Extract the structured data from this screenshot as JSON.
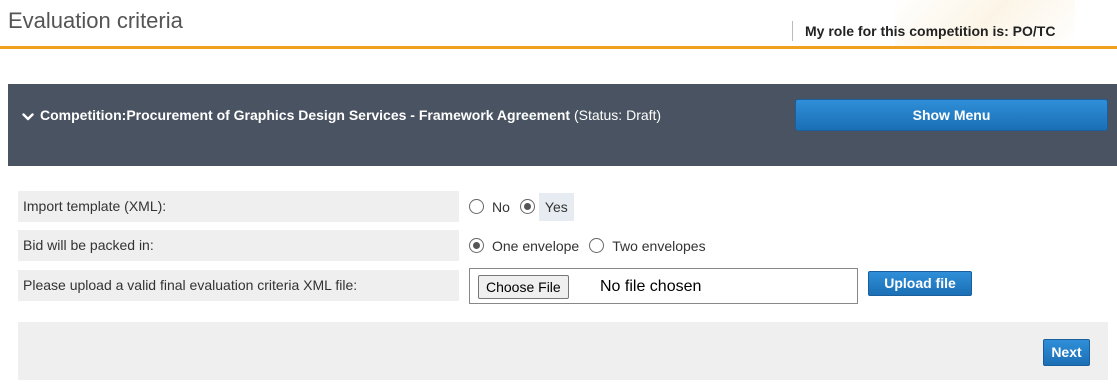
{
  "header": {
    "title": "Evaluation criteria",
    "role_text": "My role for this competition is: PO/TC",
    "accent_color": "#f0a01e"
  },
  "competition": {
    "label": "Competition:Procurement of Graphics Design Services - Framework Agreement",
    "status_text": " (Status: Draft)",
    "toggle_icon": "chevron-down-icon",
    "show_menu_label": "Show Menu",
    "bar_color": "#4a5361"
  },
  "form": {
    "import_template": {
      "label": "Import template (XML):",
      "options": [
        "No",
        "Yes"
      ],
      "selected": "Yes"
    },
    "bid_packing": {
      "label": "Bid will be packed in:",
      "options": [
        "One envelope",
        "Two envelopes"
      ],
      "selected": "One envelope"
    },
    "upload": {
      "label": "Please upload a valid final evaluation criteria XML file:",
      "choose_file_label": "Choose File",
      "file_status": "No file chosen",
      "upload_button_label": "Upload file"
    }
  },
  "footer": {
    "next_label": "Next"
  },
  "button_color": "#1f78c4"
}
